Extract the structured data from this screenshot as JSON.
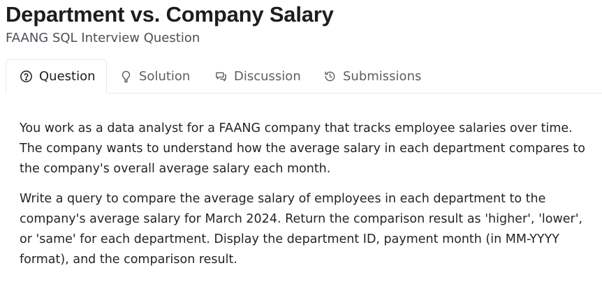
{
  "header": {
    "title": "Department vs. Company Salary",
    "subtitle": "FAANG SQL Interview Question"
  },
  "tabs": [
    {
      "label": "Question",
      "icon": "question-circle-icon",
      "active": true
    },
    {
      "label": "Solution",
      "icon": "lightbulb-icon",
      "active": false
    },
    {
      "label": "Discussion",
      "icon": "chat-bubbles-icon",
      "active": false
    },
    {
      "label": "Submissions",
      "icon": "history-icon",
      "active": false
    }
  ],
  "question": {
    "paragraphs": [
      "You work as a data analyst for a FAANG company that tracks employee salaries over time. The company wants to understand how the average salary in each department compares to the company's overall average salary each month.",
      "Write a query to compare the average salary of employees in each department to the company's average salary for March 2024. Return the comparison result as 'higher', 'lower', or 'same' for each department. Display the department ID, payment month (in MM-YYYY format), and the comparison result."
    ]
  }
}
